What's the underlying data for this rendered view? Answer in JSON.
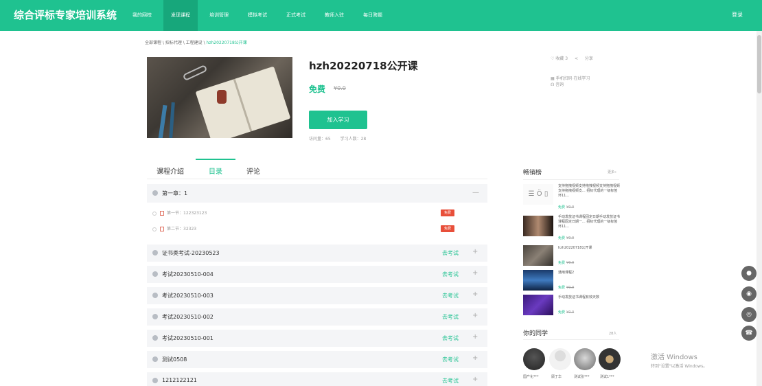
{
  "header": {
    "brand": "综合评标专家培训系统",
    "nav": [
      "我的网校",
      "发现课程",
      "培训管理",
      "模拟考试",
      "正式考试",
      "教师入驻",
      "每日答题"
    ],
    "active_nav": 1,
    "login": "登录"
  },
  "breadcrumb": {
    "path": "全部课程 \\ 招标代理 \\ 工程建设 \\ ",
    "current": "hzh20220718公开课"
  },
  "course": {
    "title": "hzh20220718公开课",
    "price_free": "免费",
    "price_orig": "¥0.0",
    "join_label": "加入学习",
    "visits": "访问量：65",
    "learners": "学习人数：28",
    "favorite": "♡ 收藏 3",
    "share": "分享",
    "mobile": "手机扫码 在线学习",
    "consult": "咨询"
  },
  "tabs": [
    "课程介绍",
    "目录",
    "评论"
  ],
  "catalog": {
    "chapter1": "第一章：1",
    "chapter1_toggle": "—",
    "sections": [
      {
        "name": "第一节：122323123",
        "tag": "免费"
      },
      {
        "name": "第二节：32323",
        "tag": "免费"
      }
    ],
    "exams": [
      {
        "name": "证书类考试-20230523",
        "action": "去考试"
      },
      {
        "name": "考试20230510-004",
        "action": "去考试"
      },
      {
        "name": "考试20230510-003",
        "action": "去考试"
      },
      {
        "name": "考试20230510-002",
        "action": "去考试"
      },
      {
        "name": "考试20230510-001",
        "action": "去考试"
      },
      {
        "name": "测试0508",
        "action": "去考试"
      },
      {
        "name": "1212122121",
        "action": "去考试"
      }
    ],
    "plus": "+"
  },
  "bestseller": {
    "title": "畅销榜",
    "more": "更多»",
    "items": [
      {
        "text": "支持拖拽视频支持拖拽视频支持拖拽视频支持拖拽视频支... 招标代理的一级标签坏11...",
        "free": "免费",
        "orig": "¥0.0"
      },
      {
        "text": "手动发放证书课程固定日期手动发放证书课程固定日期一... 招标代理的一级标签坏11...",
        "free": "免费",
        "orig": "¥0.0"
      },
      {
        "text": "hzh20220718公开课",
        "free": "免费",
        "orig": "¥0.0"
      },
      {
        "text": "通用课程2",
        "free": "免费",
        "orig": "¥0.0"
      },
      {
        "text": "手动发放证书课程有效天数",
        "free": "免费",
        "orig": "¥0.0"
      }
    ]
  },
  "classmates": {
    "title": "你的同学",
    "count": "28人",
    "names": [
      "国产化***",
      "顾丁华",
      "测试张***",
      "测试1***"
    ]
  },
  "watermark": {
    "line1": "激活 Windows",
    "line2": "转到\"设置\"以激活 Windows。"
  },
  "colors": {
    "primary": "#1fc290",
    "tag_red": "#e84f3a"
  }
}
